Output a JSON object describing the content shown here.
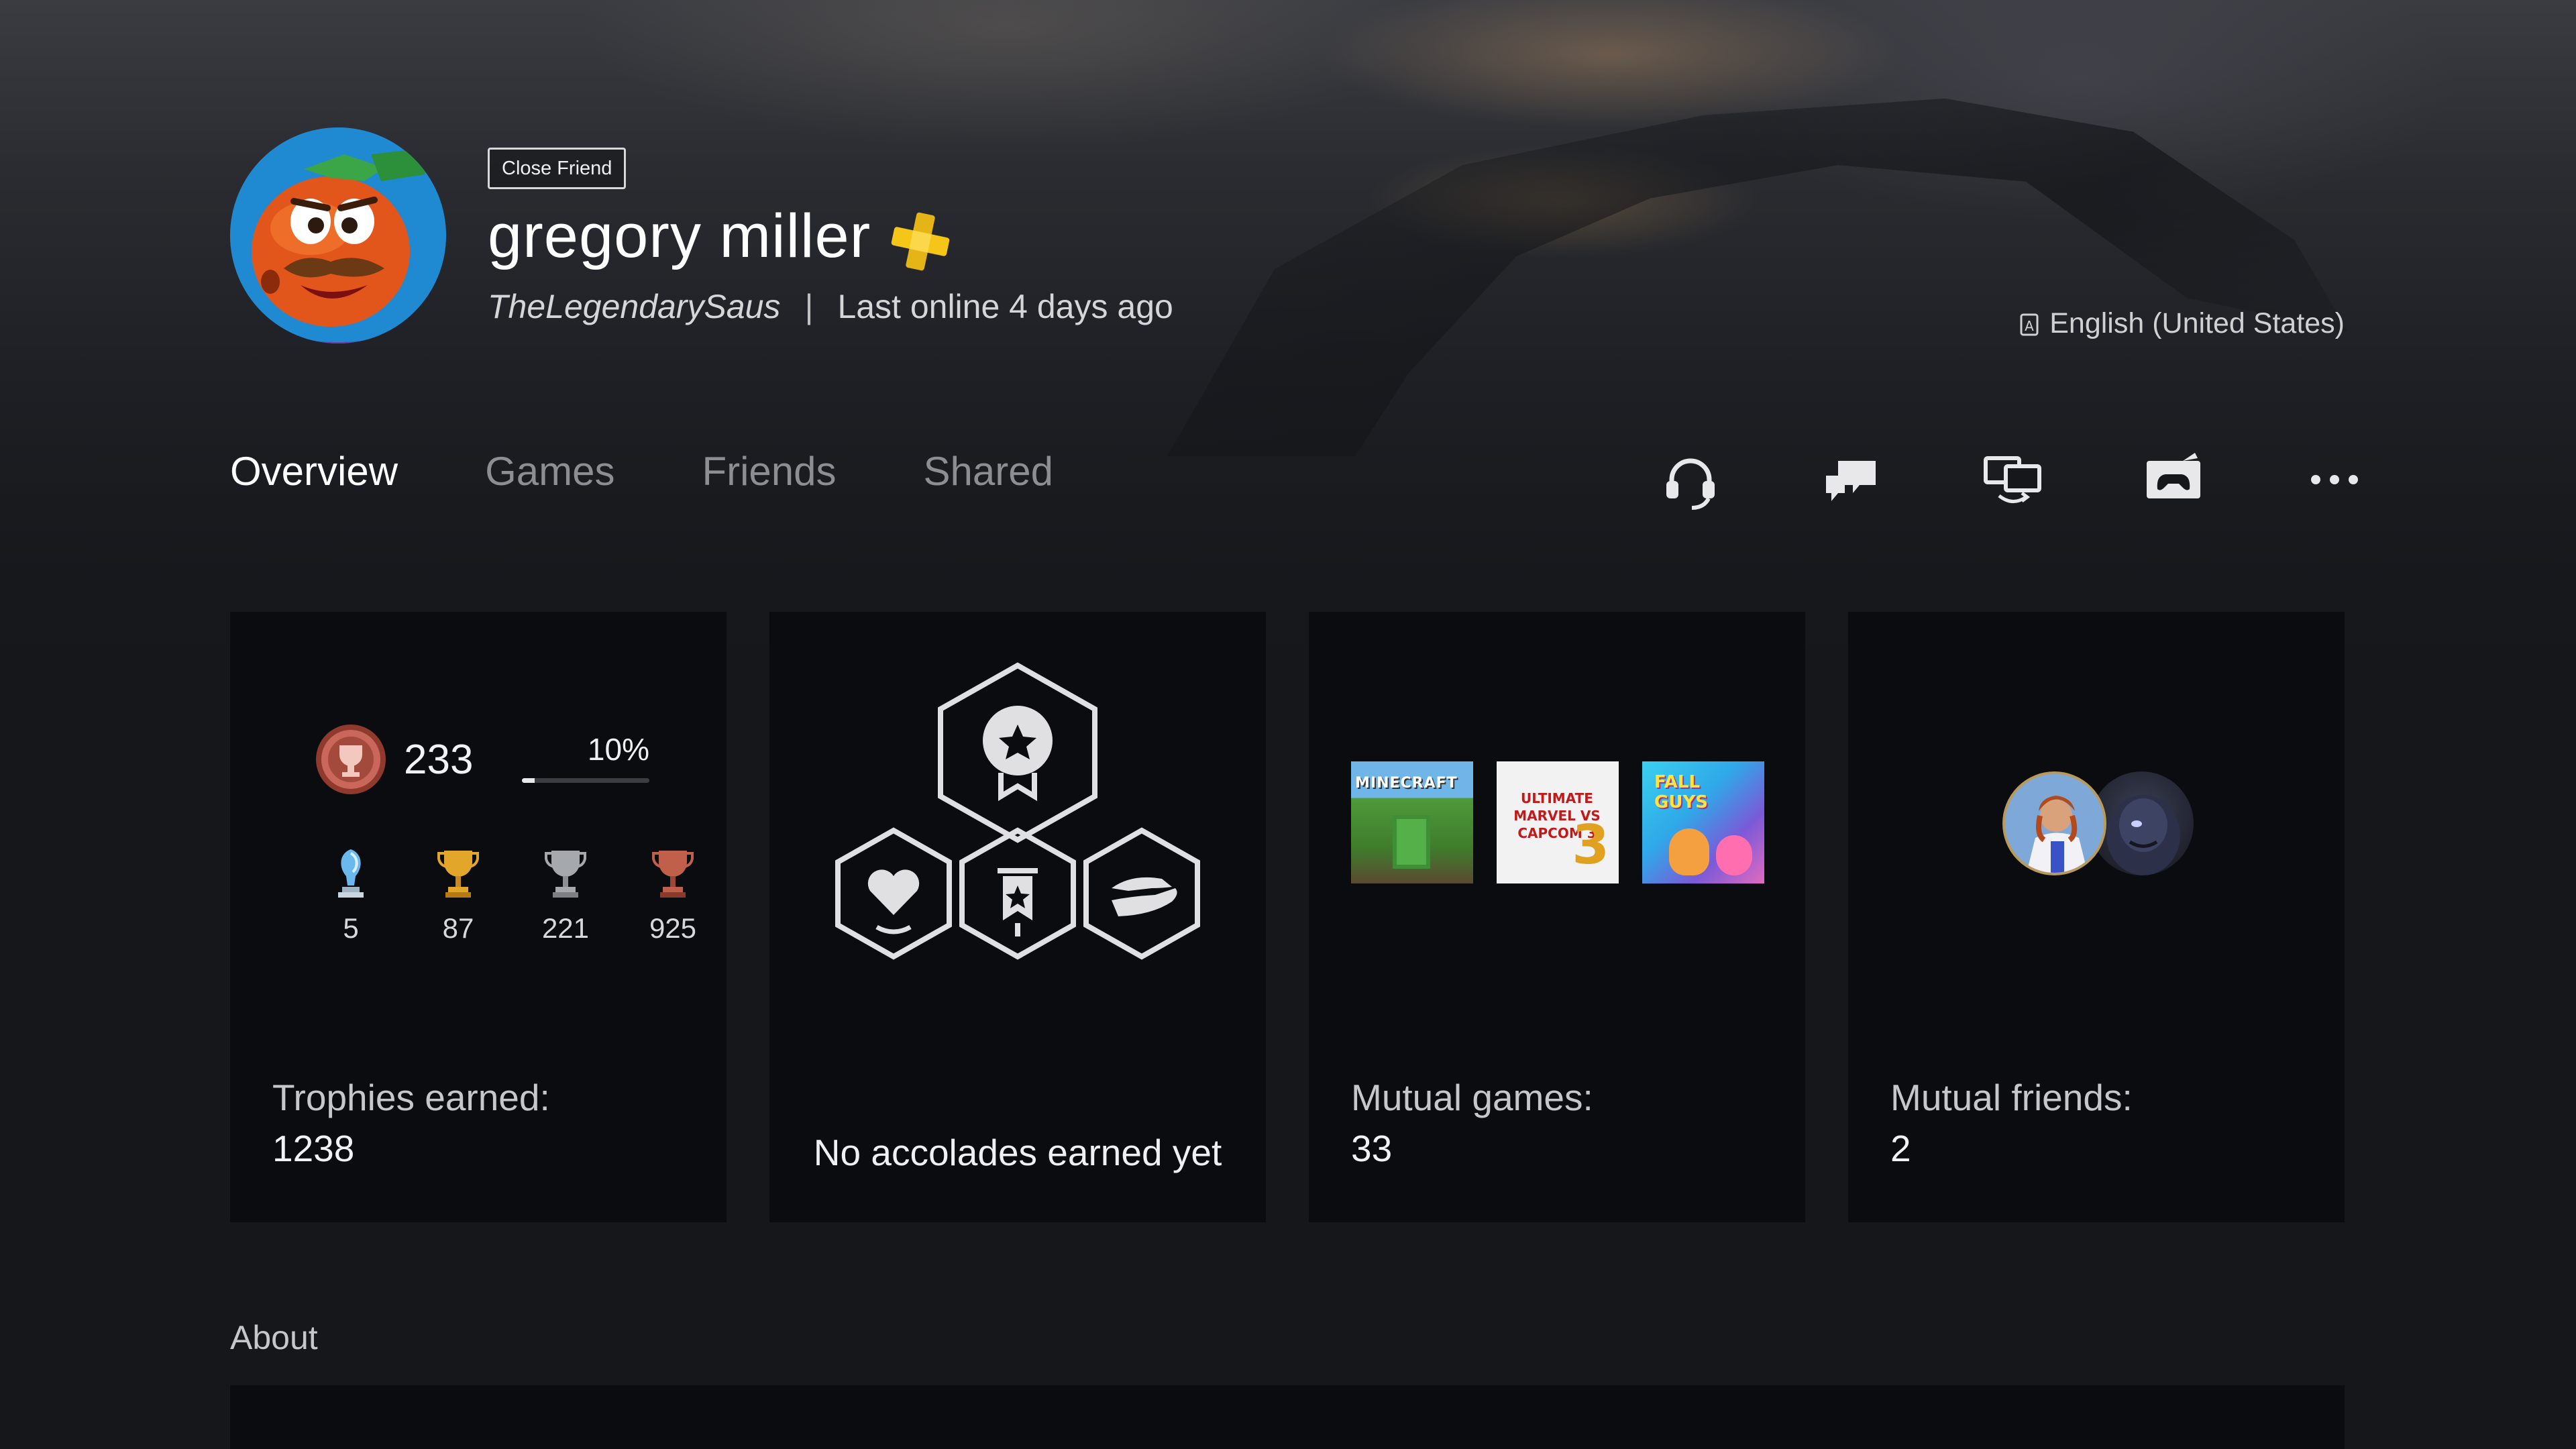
{
  "profile": {
    "badge": "Close Friend",
    "display_name": "gregory miller",
    "online_id": "TheLegendarySaus",
    "separator": "|",
    "last_online": "Last online 4 days ago",
    "language": "English (United States)",
    "plus_icon": "playstation-plus-icon",
    "colors": {
      "plus_gold": "#f5c518",
      "avatar_bg": "#1c84cf"
    }
  },
  "tabs": [
    {
      "label": "Overview",
      "active": true
    },
    {
      "label": "Games",
      "active": false
    },
    {
      "label": "Friends",
      "active": false
    },
    {
      "label": "Shared",
      "active": false
    }
  ],
  "actions": [
    {
      "icon": "headset-icon"
    },
    {
      "icon": "message-icon"
    },
    {
      "icon": "share-screen-icon"
    },
    {
      "icon": "game-invite-icon"
    },
    {
      "icon": "more-options-icon"
    }
  ],
  "trophies": {
    "level": "233",
    "progress_label": "10%",
    "progress_fraction": 0.1,
    "counts": [
      {
        "type": "platinum",
        "value": "5"
      },
      {
        "type": "gold",
        "value": "87"
      },
      {
        "type": "silver",
        "value": "221"
      },
      {
        "type": "bronze",
        "value": "925"
      }
    ],
    "label": "Trophies earned:",
    "total": "1238"
  },
  "accolades": {
    "label": "No accolades earned yet",
    "icons": [
      "medal-star-icon",
      "heart-icon",
      "banner-icon",
      "helping-hand-icon"
    ]
  },
  "mutual_games": {
    "label": "Mutual games:",
    "count": "33",
    "tiles": [
      {
        "title": "MINECRAFT"
      },
      {
        "title": "ULTIMATE MARVEL VS CAPCOM 3"
      },
      {
        "title": "FALL GUYS"
      }
    ]
  },
  "mutual_friends": {
    "label": "Mutual friends:",
    "count": "2"
  },
  "about": {
    "title": "About"
  }
}
